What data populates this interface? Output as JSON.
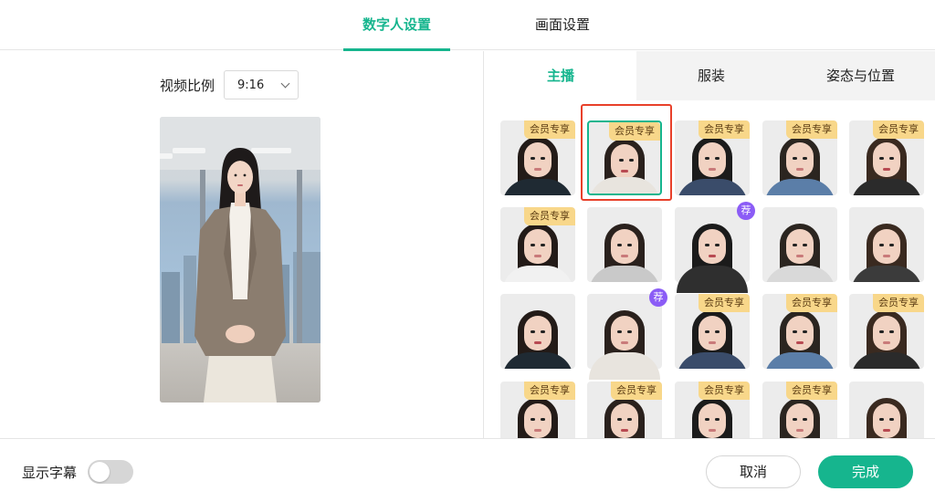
{
  "top_tabs": [
    {
      "label": "数字人设置",
      "active": true
    },
    {
      "label": "画面设置",
      "active": false
    }
  ],
  "left": {
    "ratio_label": "视频比例",
    "ratio_value": "9:16",
    "preview_icon": "digital-human-preview"
  },
  "right": {
    "sub_tabs": [
      {
        "label": "主播",
        "active": true
      },
      {
        "label": "服装",
        "active": false
      },
      {
        "label": "姿态与位置",
        "active": false
      }
    ],
    "badges": {
      "vip": "会员专享",
      "rec": "荐"
    },
    "avatars": [
      {
        "badge": "vip",
        "selected": false
      },
      {
        "badge": "vip",
        "selected": true
      },
      {
        "badge": "vip",
        "selected": false
      },
      {
        "badge": "vip",
        "selected": false
      },
      {
        "badge": "vip",
        "selected": false
      },
      {
        "badge": "vip",
        "selected": false
      },
      {
        "badge": "",
        "selected": false
      },
      {
        "badge": "rec",
        "selected": false
      },
      {
        "badge": "",
        "selected": false
      },
      {
        "badge": "",
        "selected": false
      },
      {
        "badge": "",
        "selected": false
      },
      {
        "badge": "rec",
        "selected": false
      },
      {
        "badge": "vip",
        "selected": false
      },
      {
        "badge": "vip",
        "selected": false
      },
      {
        "badge": "vip",
        "selected": false
      },
      {
        "badge": "vip",
        "selected": false
      },
      {
        "badge": "vip",
        "selected": false
      },
      {
        "badge": "vip",
        "selected": false
      },
      {
        "badge": "vip",
        "selected": false
      },
      {
        "badge": "",
        "selected": false
      }
    ]
  },
  "bottom": {
    "subtitle_label": "显示字幕",
    "subtitle_on": false,
    "cancel": "取消",
    "confirm": "完成"
  },
  "colors": {
    "accent": "#16b58e",
    "highlight": "#e8402a",
    "vip_badge": "#f8d78a",
    "rec_badge": "#8b5cf6"
  }
}
